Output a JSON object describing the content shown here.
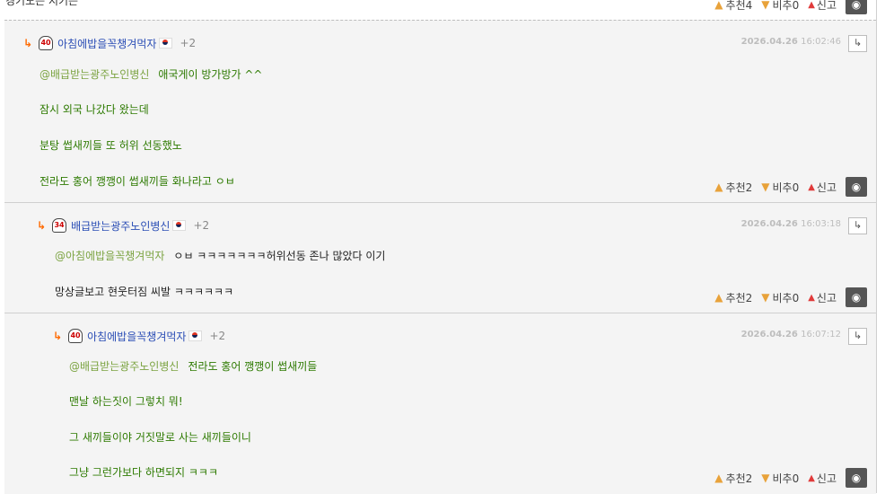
{
  "top": {
    "cut_text": "경기도는 지키는",
    "votes": {
      "up": "추천4",
      "down": "비추0",
      "report": "신고"
    }
  },
  "comments": [
    {
      "nick": "아침에밥을꼭챙겨먹자",
      "level": "40",
      "plus": "+2",
      "date": "2026.04.26",
      "time": "16:02:46",
      "mention": "@배급받는광주노인병신",
      "lines": [
        "애국게이 방가방가 ^^",
        "잠시 외국 나갔다 왔는데",
        "분탕 썹새끼들 또 허위 선동했노",
        "전라도 홍어 깽깽이 썹새끼들 화나라고 ㅇㅂ"
      ],
      "votes": {
        "up": "추천2",
        "down": "비추0",
        "report": "신고"
      }
    },
    {
      "nick": "배급받는광주노인병신",
      "level": "34",
      "plus": "+2",
      "date": "2026.04.26",
      "time": "16:03:18",
      "mention": "@아침에밥을꼭챙겨먹자",
      "lines": [
        "ㅇㅂ ㅋㅋㅋㅋㅋㅋㅋ허위선동 존나 많았다 이기",
        "망상글보고 현웃터짐 씨발 ㅋㅋㅋㅋㅋㅋ"
      ],
      "votes": {
        "up": "추천2",
        "down": "비추0",
        "report": "신고"
      }
    },
    {
      "nick": "아침에밥을꼭챙겨먹자",
      "level": "40",
      "plus": "+2",
      "date": "2026.04.26",
      "time": "16:07:12",
      "mention": "@배급받는광주노인병신",
      "lines": [
        "전라도 홍어 깽깽이 썹새끼들",
        "맨날 하는짓이 그렇치 뭐!",
        "그 새끼들이야 거짓말로 사는 새끼들이니",
        "그냥 그런가보다 하면되지 ㅋㅋㅋ"
      ],
      "votes": {
        "up": "추천2",
        "down": "비추0",
        "report": "신고"
      }
    }
  ],
  "icons": {
    "reply": "reply-arrow-icon",
    "level": "level-helmet-icon",
    "flag": "korea-flag-icon",
    "thumbs_up": "thumbs-up-icon",
    "thumbs_down": "thumbs-down-icon",
    "alert": "alert-bell-icon",
    "hide": "eye-slash-icon"
  },
  "colors": {
    "nick": "#2a4db5",
    "body_text": "#2d7a00",
    "mention": "#7ba341",
    "reply_arrow": "#ff6a00",
    "date": "#bdbdbd",
    "bg": "#f4f4f4"
  }
}
